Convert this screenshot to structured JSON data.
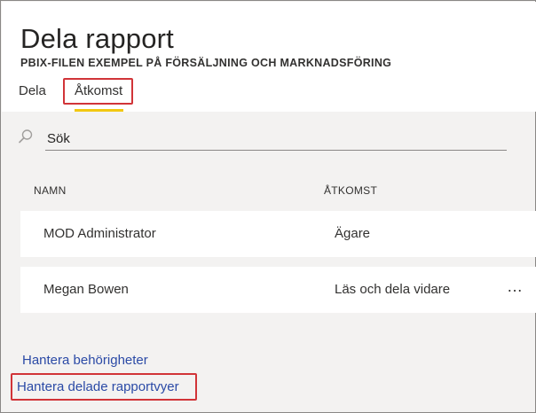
{
  "dialog": {
    "title": "Dela rapport",
    "subtitle": "PBIX-FILEN EXEMPEL PÅ FÖRSÄLJNING OCH MARKNADSFÖRING"
  },
  "tabs": [
    {
      "label": "Dela",
      "selected": false
    },
    {
      "label": "Åtkomst",
      "selected": true
    }
  ],
  "search": {
    "placeholder": "Sök",
    "value": ""
  },
  "table": {
    "columns": [
      "NAMN",
      "ÅTKOMST"
    ],
    "rows": [
      {
        "name": "MOD Administrator",
        "access": "Ägare",
        "menu": ""
      },
      {
        "name": "Megan Bowen",
        "access": "Läs och dela vidare",
        "menu": "…"
      }
    ]
  },
  "links": {
    "manage_permissions": "Hantera behörigheter",
    "manage_shared_views": "Hantera delade rapportvyer"
  },
  "colors": {
    "highlight": "#d13438",
    "tab_underline": "#f2c811",
    "link": "#2b4aa6"
  }
}
